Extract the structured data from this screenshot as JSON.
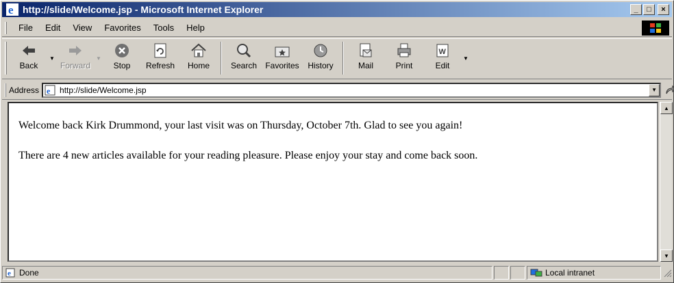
{
  "window": {
    "title": "http://slide/Welcome.jsp - Microsoft Internet Explorer",
    "controls": {
      "minimize": "_",
      "maximize": "□",
      "close": "×"
    }
  },
  "menubar": {
    "items": [
      {
        "label": "File"
      },
      {
        "label": "Edit"
      },
      {
        "label": "View"
      },
      {
        "label": "Favorites"
      },
      {
        "label": "Tools"
      },
      {
        "label": "Help"
      }
    ]
  },
  "toolbar": {
    "buttons": [
      {
        "label": "Back",
        "icon": "back-arrow-icon"
      },
      {
        "label": "Forward",
        "icon": "forward-arrow-icon"
      },
      {
        "label": "Stop",
        "icon": "stop-icon"
      },
      {
        "label": "Refresh",
        "icon": "refresh-icon"
      },
      {
        "label": "Home",
        "icon": "home-icon"
      },
      {
        "label": "Search",
        "icon": "search-icon"
      },
      {
        "label": "Favorites",
        "icon": "favorites-icon"
      },
      {
        "label": "History",
        "icon": "history-icon"
      },
      {
        "label": "Mail",
        "icon": "mail-icon"
      },
      {
        "label": "Print",
        "icon": "print-icon"
      },
      {
        "label": "Edit",
        "icon": "edit-icon"
      }
    ]
  },
  "addressbar": {
    "label": "Address",
    "url": "http://slide/Welcome.jsp",
    "go_label": "Go"
  },
  "page": {
    "line1": "Welcome back Kirk Drummond, your last visit was on Thursday, October 7th. Glad to see you again!",
    "line2": "There are 4 new articles available for your reading pleasure. Please enjoy your stay and come back soon."
  },
  "statusbar": {
    "status": "Done",
    "zone": "Local intranet"
  },
  "colors": {
    "titlebar_start": "#0a246a",
    "titlebar_end": "#a6caf0",
    "chrome": "#d4d0c8"
  }
}
